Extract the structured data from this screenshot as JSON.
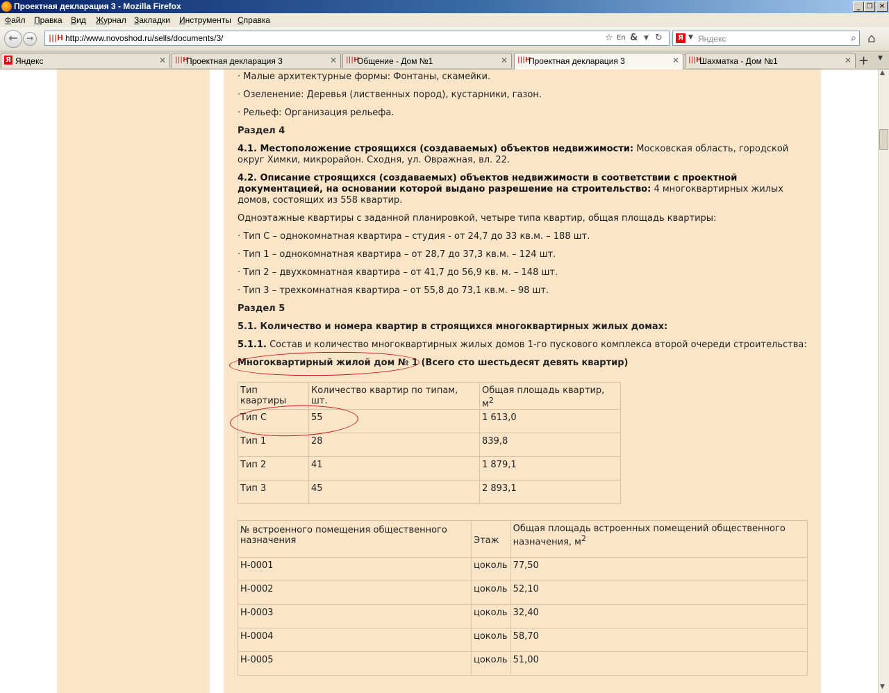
{
  "window": {
    "title": "Проектная декларация 3 - Mozilla Firefox"
  },
  "menu": [
    "Файл",
    "Правка",
    "Вид",
    "Журнал",
    "Закладки",
    "Инструменты",
    "Справка"
  ],
  "nav": {
    "url": "http://www.novoshod.ru/sells/documents/3/",
    "search_placeholder": "Яндекс",
    "search_engine_logo": "Я"
  },
  "tabs": [
    {
      "label": "Яндекс",
      "icon": "yandex-icon",
      "active": false
    },
    {
      "label": "Проектная декларация 3",
      "icon": "site-icon",
      "active": false
    },
    {
      "label": "Общение - Дом №1",
      "icon": "site-icon",
      "active": false
    },
    {
      "label": "Проектная декларация 3",
      "icon": "site-icon",
      "active": true
    },
    {
      "label": "Шахматка - Дом №1",
      "icon": "site-icon",
      "active": false
    }
  ],
  "content": {
    "line_forms": "· Малые архитектурные формы: Фонтаны, скамейки.",
    "line_green": "· Озеленение: Деревья (лиственных пород), кустарники, газон.",
    "line_relief": "· Рельеф: Организация рельефа.",
    "section4": "Раздел 4",
    "p41_bold": "4.1. Местоположение строящихся (создаваемых) объектов недвижимости:",
    "p41_text": " Московская область, городской округ Химки, микрорайон. Сходня, ул. Овражная, вл. 22.",
    "p42_bold": "4.2. Описание строящихся (создаваемых) объектов недвижимости в соответствии с проектной документацией, на основании которой выдано разрешение на строительство:",
    "p42_text": " 4 многоквартирных жилых домов, состоящих из 558 квартир.",
    "p_layout": "Одноэтажные квартиры с заданной планировкой, четыре типа квартир, общая площадь квартиры:",
    "type_c": "· Тип С – однокомнатная квартира – студия - от 24,7 до 33 кв.м. – 188 шт.",
    "type_1": "· Тип 1 – однокомнатная квартира – от 28,7 до 37,3 кв.м. – 124 шт.",
    "type_2": "· Тип 2 – двухкомнатная квартира – от 41,7 до 56,9 кв. м. – 148 шт.",
    "type_3": "· Тип 3 – трехкомнатная квартира – от 55,8 до 73,1 кв.м. – 98 шт.",
    "section5": "Раздел 5",
    "p51_bold": "5.1. Количество и номера квартир в строящихся многоквартирных жилых домах:",
    "p511_bold": "5.1.1.",
    "p511_text": " Состав и количество многоквартирных жилых домов 1-го пускового комплекса второй очереди строительства:",
    "house1_title": "Многоквартирный жилой дом № 1 (Всего сто шестьдесят девять квартир)"
  },
  "apartments_table": {
    "headers": [
      "Тип квартиры",
      "Количество квартир по типам, шт.",
      "Общая площадь квартир, м"
    ],
    "header_sup": "2",
    "rows": [
      [
        "Тип С",
        "55",
        "1 613,0"
      ],
      [
        "Тип 1",
        "28",
        "839,8"
      ],
      [
        "Тип 2",
        "41",
        "1 879,1"
      ],
      [
        "Тип 3",
        "45",
        "2 893,1"
      ]
    ]
  },
  "premises_table": {
    "headers": [
      "№ встроенного помещения общественного назначения",
      "Этаж",
      "Общая площадь встроенных помещений общественного назначения, м"
    ],
    "header_sup": "2",
    "rows": [
      [
        "Н-0001",
        "цоколь",
        "77,50"
      ],
      [
        "Н-0002",
        "цоколь",
        "52,10"
      ],
      [
        "Н-0003",
        "цоколь",
        "32,40"
      ],
      [
        "Н-0004",
        "цоколь",
        "58,70"
      ],
      [
        "Н-0005",
        "цоколь",
        "51,00"
      ]
    ]
  },
  "colors": {
    "page_bg": "#fae5c9",
    "annotation": "#cc1111",
    "titlebar": "#0a246a"
  }
}
